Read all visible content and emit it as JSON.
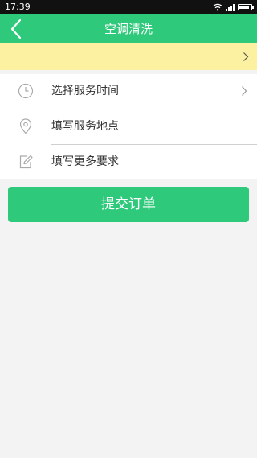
{
  "status_bar": {
    "time": "17:39",
    "battery_level": 0.85
  },
  "header": {
    "title": "空调清洗",
    "background": "#2fc97b"
  },
  "notice": {
    "text": "",
    "background": "#fbf1a0"
  },
  "form": {
    "rows": [
      {
        "label": "选择服务时间",
        "icon": "clock-icon",
        "has_chevron": true
      },
      {
        "label": "填写服务地点",
        "icon": "location-pin-icon",
        "has_chevron": false
      },
      {
        "label": "填写更多要求",
        "icon": "edit-icon",
        "has_chevron": false
      }
    ]
  },
  "submit": {
    "label": "提交订单",
    "background": "#2fc97b"
  }
}
